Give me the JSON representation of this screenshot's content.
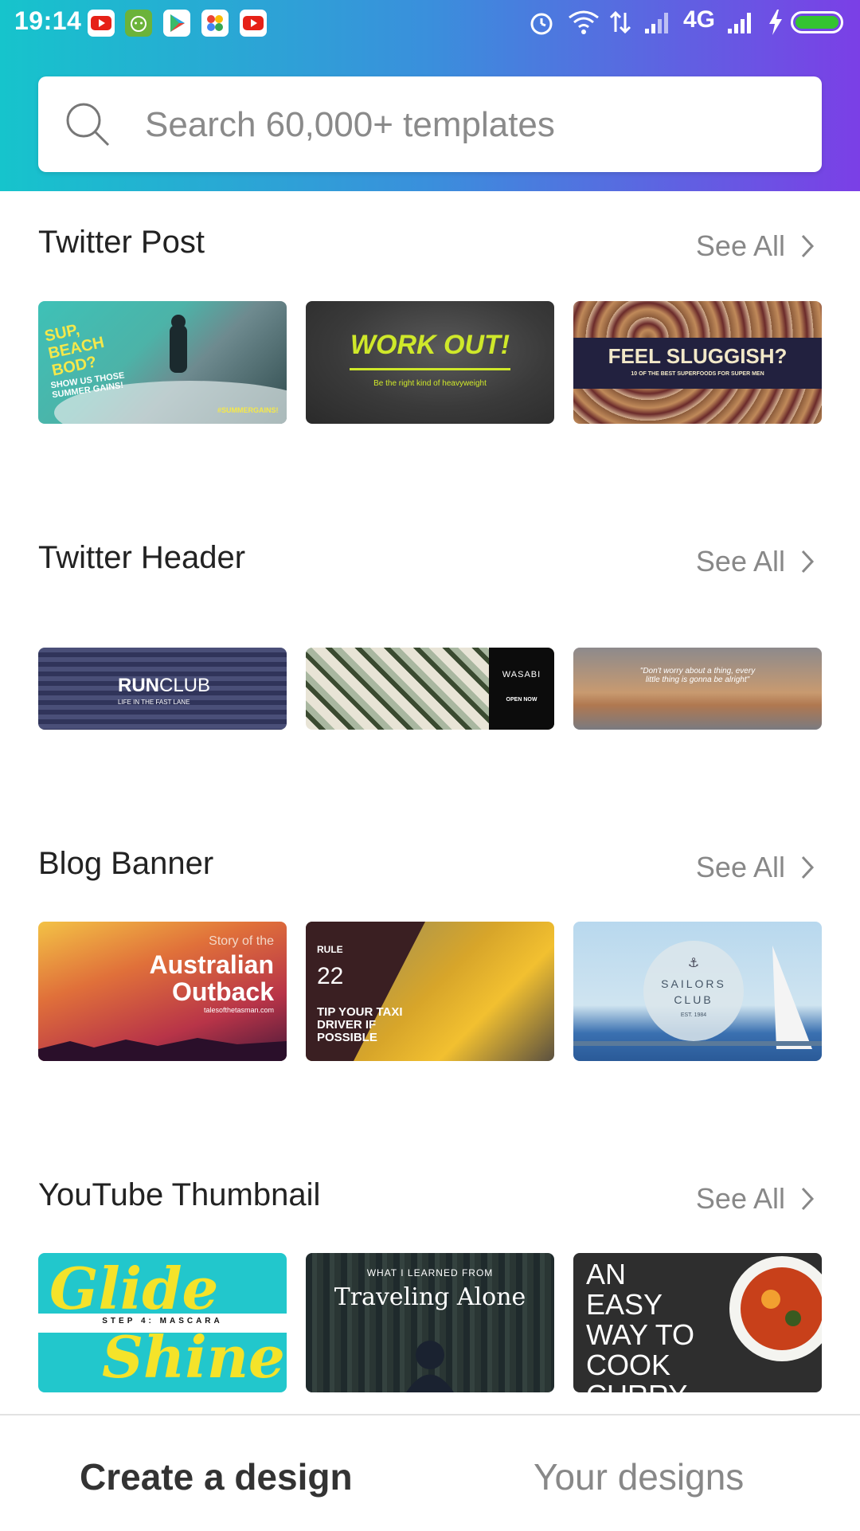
{
  "status_bar": {
    "time": "19:14",
    "network": "4G",
    "icons": [
      "youtube-icon",
      "android-icon",
      "play-store-icon",
      "google-photos-icon",
      "youtube-icon",
      "alarm-icon",
      "wifi-icon",
      "data-arrows-icon",
      "signal-icon",
      "signal-icon",
      "charging-icon",
      "battery-icon"
    ],
    "battery_color": "#34c431"
  },
  "header": {
    "gradient": [
      "#16c4cc",
      "#3a8fdc",
      "#7b3fe6"
    ],
    "search_placeholder": "Search 60,000+ templates"
  },
  "sections": [
    {
      "title": "Twitter Post",
      "see_all": "See All",
      "cards": [
        {
          "lines": [
            "SUP, BEACH BOD?",
            "SHOW US THOSE SUMMER GAINS!",
            "#SUMMERGAINS!"
          ]
        },
        {
          "lines": [
            "WORK OUT!",
            "Be the right kind of heavyweight"
          ]
        },
        {
          "lines": [
            "FEEL SLUGGISH?",
            "10 OF THE BEST SUPERFOODS FOR SUPER MEN"
          ]
        }
      ]
    },
    {
      "title": "Twitter Header",
      "see_all": "See All",
      "cards": [
        {
          "lines": [
            "RUN",
            "CLUB",
            "LIFE IN THE FAST LANE"
          ]
        },
        {
          "lines": [
            "WASABI",
            "OPEN NOW"
          ]
        },
        {
          "lines": [
            "\"Don't worry about a thing, every little thing is gonna be alright\""
          ]
        }
      ]
    },
    {
      "title": "Blog Banner",
      "see_all": "See All",
      "cards": [
        {
          "lines": [
            "Story of the",
            "Australian",
            "Outback",
            "talesofthetasman.com"
          ]
        },
        {
          "lines": [
            "RULE",
            "22",
            "TIP YOUR TAXI DRIVER IF POSSIBLE"
          ]
        },
        {
          "lines": [
            "SAILORS",
            "CLUB",
            "EST. 1984"
          ]
        }
      ]
    },
    {
      "title": "YouTube Thumbnail",
      "see_all": "See All",
      "cards": [
        {
          "lines": [
            "Glide",
            "STEP 4: MASCARA",
            "Shine"
          ]
        },
        {
          "lines": [
            "WHAT I LEARNED FROM",
            "Traveling Alone"
          ]
        },
        {
          "lines": [
            "AN EASY WAY TO COOK CURRY"
          ]
        }
      ]
    }
  ],
  "bottom_nav": {
    "create": "Create a design",
    "yours": "Your designs"
  }
}
